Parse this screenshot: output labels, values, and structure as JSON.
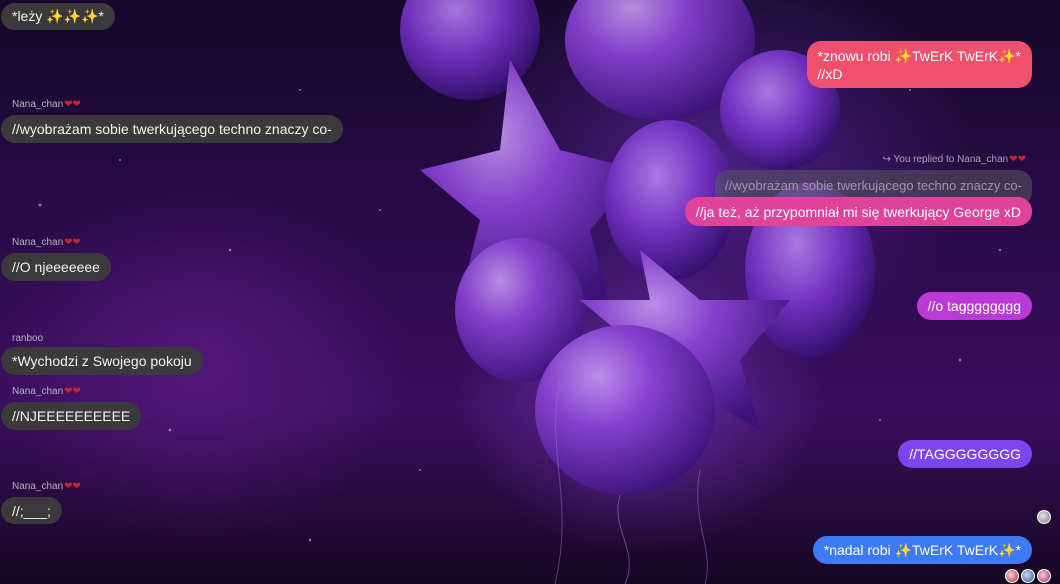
{
  "messages_left": [
    {
      "text": "*leży ✨✨✨*"
    },
    {
      "sender": "Nana_chan",
      "hearts": "❤❤",
      "text": "//wyobrażam sobie twerkującego techno znaczy co-"
    },
    {
      "sender": "Nana_chan",
      "hearts": "❤❤",
      "text": "//O njeeeeeee"
    },
    {
      "sender": "ranboo",
      "text": "*Wychodzi z Swojego pokoju"
    },
    {
      "sender": "Nana_chan",
      "hearts": "❤❤",
      "text": "//NJEEEEEEEEEE"
    },
    {
      "sender": "Nana_chan",
      "hearts": "❤❤",
      "text": "//;___;"
    }
  ],
  "messages_right": [
    {
      "line1": "*znowu robi ✨TwErK TwErK✨*",
      "line2": "//xD",
      "color": "#f0506e"
    },
    {
      "replied_label": "You replied to Nana_chan",
      "hearts": "❤❤",
      "quote": "//wyobrażam sobie twerkującego techno znaczy co-",
      "text": "//ja też, aż przypomniał mi się twerkujący George xD",
      "color": "#e0439a"
    },
    {
      "text": "//o tagggggggg",
      "color": "#b93ad6"
    },
    {
      "text": "//TAGGGGGGGG",
      "color": "#7b45ef"
    },
    {
      "text": "*nadal robi ✨TwErK TwErK✨*",
      "color": "#3d7af5"
    }
  ],
  "colors": {
    "left_bubble": "#3a3a3c",
    "heart": "#c0262e"
  }
}
